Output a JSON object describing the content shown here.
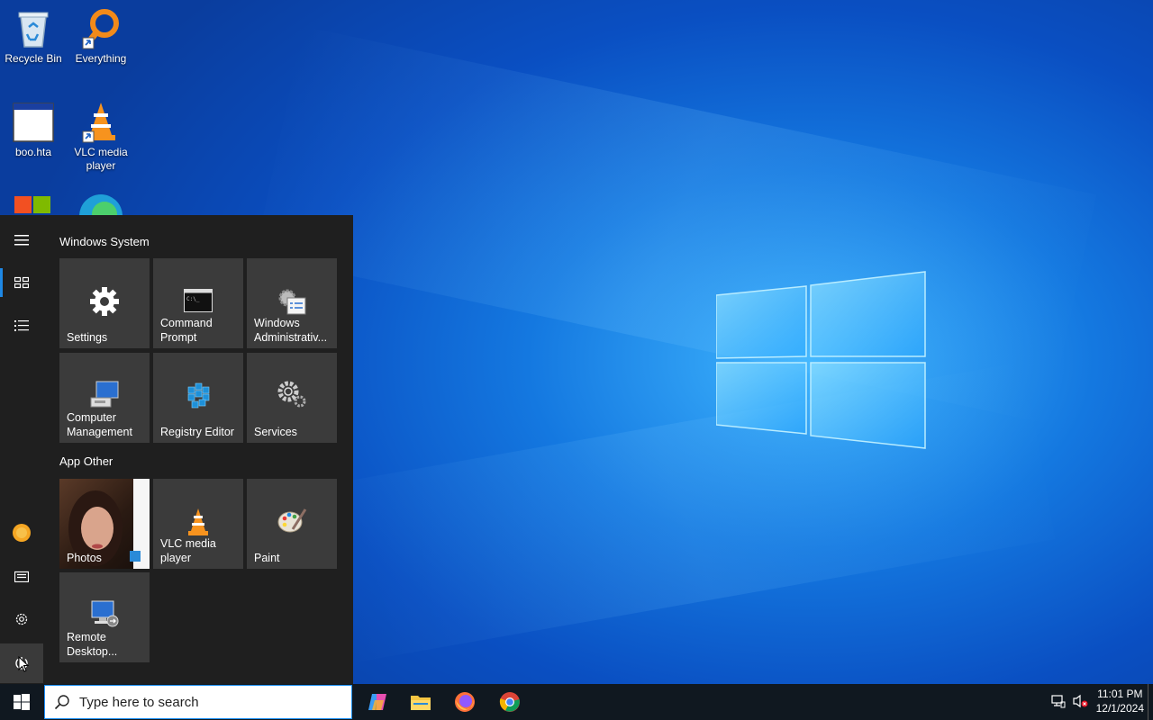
{
  "desktop": {
    "icons": [
      {
        "label": "Recycle Bin"
      },
      {
        "label": "Everything"
      },
      {
        "label": "boo.hta"
      },
      {
        "label": "VLC media player"
      }
    ]
  },
  "start_menu": {
    "groups": [
      {
        "title": "Windows System",
        "tiles": [
          {
            "label": "Settings",
            "icon": "gear-icon"
          },
          {
            "label": "Command\nPrompt",
            "icon": "command-prompt-icon"
          },
          {
            "label": "Windows\nAdministrativ...",
            "icon": "admin-tools-icon"
          },
          {
            "label": "Computer\nManagement",
            "icon": "computer-management-icon"
          },
          {
            "label": "Registry Editor",
            "icon": "registry-editor-icon"
          },
          {
            "label": "Services",
            "icon": "services-icon"
          }
        ]
      },
      {
        "title": "App Other",
        "tiles": [
          {
            "label": "Photos",
            "icon": "photos-icon"
          },
          {
            "label": "VLC media\nplayer",
            "icon": "vlc-icon"
          },
          {
            "label": "Paint",
            "icon": "paint-icon"
          },
          {
            "label": "Remote\nDesktop...",
            "icon": "remote-desktop-icon"
          }
        ]
      }
    ]
  },
  "taskbar": {
    "search_placeholder": "Type here to search",
    "time": "11:01 PM",
    "date": "12/1/2024"
  },
  "colors": {
    "accent": "#1e88e5",
    "tile_bg": "#3b3b3b",
    "menu_bg": "#1f1f1f",
    "taskbar_bg": "#101820"
  }
}
